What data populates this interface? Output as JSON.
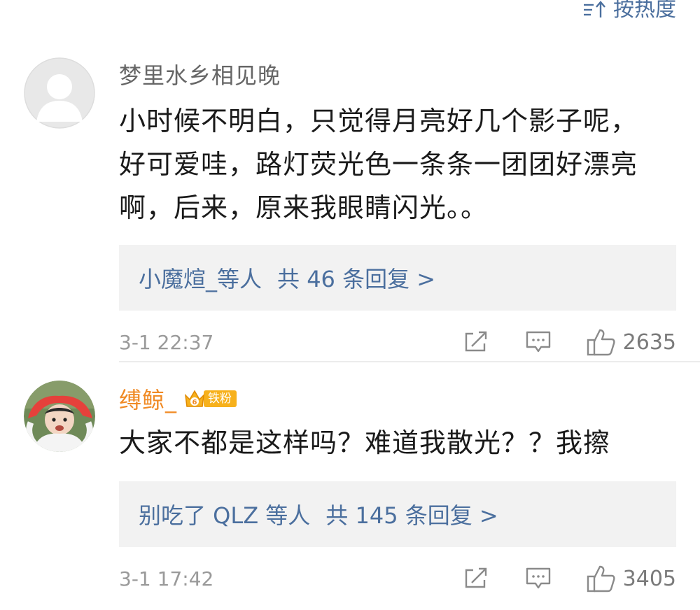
{
  "sort": {
    "label": "按热度",
    "icon": "sort-icon"
  },
  "comments": [
    {
      "username": "梦里水乡相见晚",
      "avatar": "default-avatar-icon",
      "text_lines": [
        "小时候不明白，只觉得月亮好几个影子呢，",
        "好可爱哇，路灯荧光色一条条一团团好漂亮",
        "啊，后来，原来我眼睛闪光。。"
      ],
      "replies_who": "小魔煊_等人",
      "replies_count": "共 46 条回复 >",
      "timestamp": "3-1 22:37",
      "likes": "2635"
    },
    {
      "username": "缚鲸_",
      "avatar": "child-photo-avatar",
      "badge_level": "6",
      "badge_label": "铁粉",
      "text_lines": [
        "大家不都是这样吗？难道我散光？？我擦"
      ],
      "replies_who": "别吃了 QLZ 等人",
      "replies_count": "共 145 条回复 >",
      "timestamp": "3-1 17:42",
      "likes": "3405"
    }
  ],
  "colors": {
    "link_blue": "#4b6f9e",
    "vip_orange": "#f08a24",
    "badge_gold": "#f7b11c",
    "reply_bg": "#f2f2f2",
    "meta_gray": "#9a9a9a"
  }
}
